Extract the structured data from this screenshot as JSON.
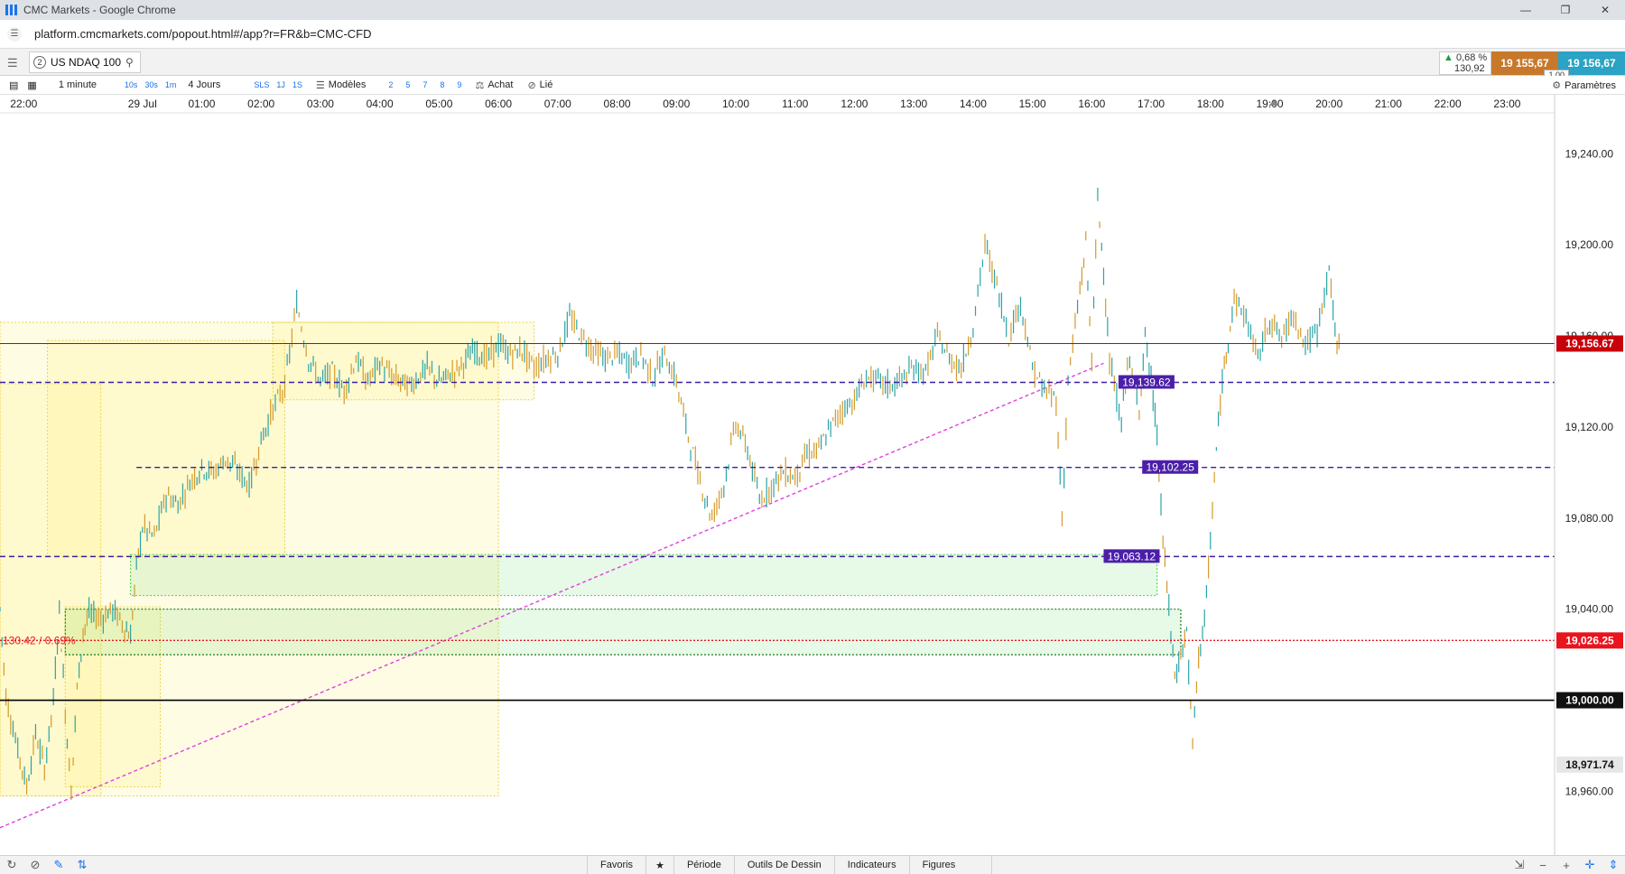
{
  "window": {
    "title": "CMC Markets - Google Chrome",
    "url": "platform.cmcmarkets.com/popout.html#/app?r=FR&b=CMC-CFD"
  },
  "instrument": {
    "link_number": "2",
    "symbol": "US NDAQ 100",
    "change_pct": "0,68 %",
    "change_abs": "130,92",
    "sell": "19 155,67",
    "buy": "19 156,67",
    "spread": "1,00"
  },
  "toolbar": {
    "interval": "1 minute",
    "quick_intervals": [
      "10s",
      "30s",
      "1m"
    ],
    "period": "4 Jours",
    "quick_periods": [
      "SLS",
      "1J",
      "1S"
    ],
    "templates": "Modèles",
    "layout_numbers": [
      "2",
      "5",
      "7",
      "8",
      "9"
    ],
    "buy": "Achat",
    "linked": "Lié",
    "settings": "Paramètres"
  },
  "bottombar": {
    "favorites": "Favoris",
    "period": "Période",
    "drawing_tools": "Outils De Dessin",
    "indicators": "Indicateurs",
    "figures": "Figures",
    "zoom_minus": "−",
    "zoom_plus": "+"
  },
  "chart_data": {
    "type": "candlestick",
    "time_labels": [
      "22:00",
      "29 Jul",
      "01:00",
      "02:00",
      "03:00",
      "04:00",
      "05:00",
      "06:00",
      "07:00",
      "08:00",
      "09:00",
      "10:00",
      "11:00",
      "12:00",
      "13:00",
      "14:00",
      "15:00",
      "16:00",
      "17:00",
      "18:00",
      "19:00",
      "20:00",
      "21:00",
      "22:00",
      "23:00"
    ],
    "time_hours": [
      -2,
      0,
      1,
      2,
      3,
      4,
      5,
      6,
      7,
      8,
      9,
      10,
      11,
      12,
      13,
      14,
      15,
      16,
      17,
      18,
      19,
      20,
      21,
      22,
      23
    ],
    "x_range_hours": [
      -2.4,
      23.8
    ],
    "y_range": [
      18932,
      19258
    ],
    "y_ticks": [
      18960,
      19000,
      19040,
      19080,
      19120,
      19160,
      19200,
      19240
    ],
    "y_tick_labels": [
      "18,960.00",
      "19,000.00",
      "19,040.00",
      "19,080.00",
      "19,120.00",
      "19,160.00",
      "19,200.00",
      "19,240.00"
    ],
    "current_price": {
      "value": 19156.67,
      "label": "19,156.67",
      "color": "#c8000a"
    },
    "horizontal_levels": [
      {
        "value": 19139.62,
        "label": "19,139.62",
        "start_hour": -2.4,
        "color": "#3d1fa0",
        "style": "dashed"
      },
      {
        "value": 19102.25,
        "label": "19,102.25",
        "start_hour": -0.1,
        "color": "#3d1fa0",
        "style": "dashed"
      },
      {
        "value": 19063.12,
        "label": "19,063.12",
        "start_hour": -2.4,
        "color": "#3d1fa0",
        "style": "dashed"
      },
      {
        "value": 19026.25,
        "label": "19,026.25",
        "start_hour": -2.4,
        "color": "#e8141e",
        "style": "dotted"
      },
      {
        "value": 19000.0,
        "label": "19,000.00",
        "start_hour": -2.4,
        "color": "#000000",
        "style": "solid"
      }
    ],
    "low_label": {
      "value": 18971.74,
      "label": "18,971.74"
    },
    "measure_label": "130.42 / 0.69%",
    "trendline": {
      "from": [
        -2.4,
        18944
      ],
      "to": [
        16.2,
        19148
      ]
    },
    "yellow_zones": [
      {
        "x0": -2.4,
        "x1": 6.0,
        "y0": 18958,
        "y1": 19166
      },
      {
        "x0": -1.6,
        "x1": 2.4,
        "y0": 19063,
        "y1": 19158
      },
      {
        "x0": -2.4,
        "x1": -0.7,
        "y0": 18958,
        "y1": 19139
      },
      {
        "x0": 2.2,
        "x1": 6.6,
        "y0": 19132,
        "y1": 19166
      },
      {
        "x0": -1.3,
        "x1": 0.3,
        "y0": 18962,
        "y1": 19041
      }
    ],
    "green_zones": [
      {
        "x0": -0.2,
        "x1": 17.1,
        "y0": 19046,
        "y1": 19064
      },
      {
        "x0": -1.3,
        "x1": 17.5,
        "y0": 19020,
        "y1": 19040
      }
    ],
    "price_path": [
      [
        -2.4,
        19040
      ],
      [
        -2.3,
        19002
      ],
      [
        -2.1,
        18978
      ],
      [
        -1.95,
        18962
      ],
      [
        -1.8,
        18985
      ],
      [
        -1.65,
        18970
      ],
      [
        -1.5,
        19000
      ],
      [
        -1.4,
        19040
      ],
      [
        -1.3,
        18995
      ],
      [
        -1.2,
        18960
      ],
      [
        -1.1,
        19005
      ],
      [
        -1.0,
        19030
      ],
      [
        -0.9,
        19038
      ],
      [
        -0.7,
        19036
      ],
      [
        -0.5,
        19040
      ],
      [
        -0.3,
        19032
      ],
      [
        -0.2,
        19028
      ],
      [
        -0.1,
        19058
      ],
      [
        0.0,
        19076
      ],
      [
        0.2,
        19072
      ],
      [
        0.4,
        19090
      ],
      [
        0.6,
        19086
      ],
      [
        0.8,
        19096
      ],
      [
        1.0,
        19102
      ],
      [
        1.2,
        19100
      ],
      [
        1.4,
        19106
      ],
      [
        1.6,
        19101
      ],
      [
        1.8,
        19094
      ],
      [
        2.0,
        19114
      ],
      [
        2.2,
        19128
      ],
      [
        2.4,
        19138
      ],
      [
        2.6,
        19174
      ],
      [
        2.8,
        19150
      ],
      [
        3.0,
        19140
      ],
      [
        3.2,
        19144
      ],
      [
        3.4,
        19136
      ],
      [
        3.6,
        19150
      ],
      [
        3.8,
        19140
      ],
      [
        4.0,
        19148
      ],
      [
        4.2,
        19142
      ],
      [
        4.5,
        19138
      ],
      [
        4.8,
        19146
      ],
      [
        5.0,
        19140
      ],
      [
        5.3,
        19145
      ],
      [
        5.6,
        19154
      ],
      [
        5.8,
        19150
      ],
      [
        6.0,
        19156
      ],
      [
        6.2,
        19152
      ],
      [
        6.4,
        19154
      ],
      [
        6.6,
        19146
      ],
      [
        6.8,
        19150
      ],
      [
        7.0,
        19152
      ],
      [
        7.2,
        19168
      ],
      [
        7.4,
        19160
      ],
      [
        7.6,
        19154
      ],
      [
        7.8,
        19150
      ],
      [
        8.0,
        19152
      ],
      [
        8.2,
        19148
      ],
      [
        8.4,
        19152
      ],
      [
        8.6,
        19142
      ],
      [
        8.8,
        19152
      ],
      [
        9.0,
        19140
      ],
      [
        9.2,
        19116
      ],
      [
        9.4,
        19096
      ],
      [
        9.6,
        19080
      ],
      [
        9.8,
        19095
      ],
      [
        10.0,
        19122
      ],
      [
        10.2,
        19110
      ],
      [
        10.4,
        19088
      ],
      [
        10.6,
        19094
      ],
      [
        10.8,
        19100
      ],
      [
        11.0,
        19098
      ],
      [
        11.2,
        19108
      ],
      [
        11.4,
        19110
      ],
      [
        11.6,
        19120
      ],
      [
        11.8,
        19128
      ],
      [
        12.0,
        19132
      ],
      [
        12.2,
        19142
      ],
      [
        12.4,
        19140
      ],
      [
        12.6,
        19138
      ],
      [
        12.8,
        19141
      ],
      [
        13.0,
        19146
      ],
      [
        13.2,
        19144
      ],
      [
        13.4,
        19160
      ],
      [
        13.6,
        19150
      ],
      [
        13.8,
        19146
      ],
      [
        14.0,
        19164
      ],
      [
        14.2,
        19200
      ],
      [
        14.4,
        19182
      ],
      [
        14.6,
        19160
      ],
      [
        14.8,
        19175
      ],
      [
        15.0,
        19146
      ],
      [
        15.2,
        19136
      ],
      [
        15.4,
        19132
      ],
      [
        15.5,
        19080
      ],
      [
        15.6,
        19140
      ],
      [
        15.8,
        19180
      ],
      [
        15.9,
        19200
      ],
      [
        16.0,
        19150
      ],
      [
        16.1,
        19220
      ],
      [
        16.2,
        19190
      ],
      [
        16.3,
        19148
      ],
      [
        16.5,
        19122
      ],
      [
        16.6,
        19150
      ],
      [
        16.8,
        19130
      ],
      [
        16.9,
        19160
      ],
      [
        17.0,
        19140
      ],
      [
        17.1,
        19116
      ],
      [
        17.2,
        19070
      ],
      [
        17.3,
        19040
      ],
      [
        17.4,
        19010
      ],
      [
        17.5,
        19020
      ],
      [
        17.6,
        19030
      ],
      [
        17.7,
        18980
      ],
      [
        17.8,
        19020
      ],
      [
        17.9,
        19034
      ],
      [
        18.0,
        19070
      ],
      [
        18.1,
        19110
      ],
      [
        18.2,
        19140
      ],
      [
        18.3,
        19160
      ],
      [
        18.4,
        19176
      ],
      [
        18.6,
        19168
      ],
      [
        18.8,
        19150
      ],
      [
        19.0,
        19168
      ],
      [
        19.2,
        19158
      ],
      [
        19.4,
        19170
      ],
      [
        19.6,
        19156
      ],
      [
        19.8,
        19162
      ],
      [
        20.0,
        19190
      ],
      [
        20.1,
        19160
      ],
      [
        20.2,
        19156
      ]
    ]
  }
}
